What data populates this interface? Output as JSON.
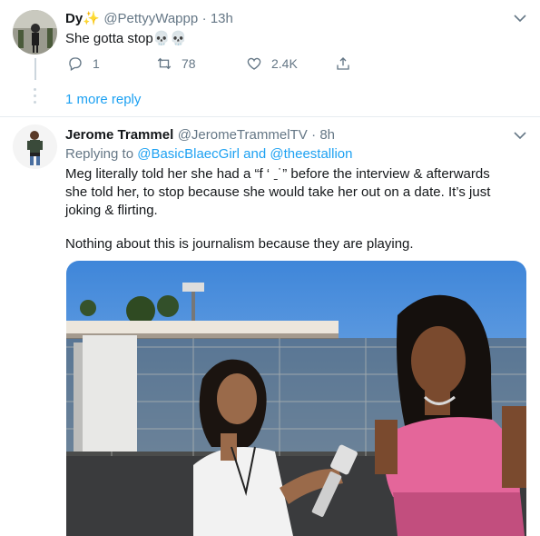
{
  "tweet1": {
    "name": "Dy✨",
    "handle": "@PettyyWappp",
    "time": "· 13h",
    "text": "She gotta stop💀💀",
    "actions": {
      "reply": "1",
      "retweet": "78",
      "like": "2.4K"
    },
    "more_reply": "1 more reply"
  },
  "tweet2": {
    "name": "Jerome Trammel",
    "handle": "@JeromeTrammelTV",
    "time": "· 8h",
    "reply_prefix": "Replying to",
    "reply_user1": "@BasicBlaecGirl",
    "reply_and": "and",
    "reply_user2": "@theestallion",
    "line1": "Meg literally told her she had a “f ‘ ˍ˙” before the interview & afterwards",
    "line2": "she told her, to stop because she would take her out on a date. It’s just",
    "line3": "joking & flirting.",
    "line4": "Nothing about this is journalism because they are playing."
  },
  "colors": {
    "accent": "#1da1f2",
    "muted": "#657786",
    "text": "#14171a"
  },
  "icons": [
    "chevron-down-icon",
    "reply-icon",
    "retweet-icon",
    "like-icon",
    "share-icon"
  ]
}
